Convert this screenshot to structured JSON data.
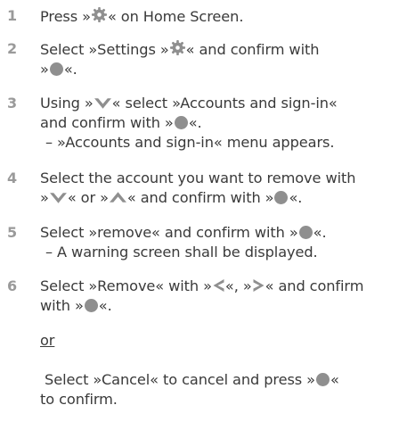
{
  "colors": {
    "text": "#3a3a3a",
    "step_number": "#9a9a9a",
    "symbol": "#8f8f8f"
  },
  "icons": {
    "gear": "gear-icon",
    "ok": "ok-button-icon",
    "down": "arrow-down-icon",
    "up": "arrow-up-icon",
    "left": "arrow-left-icon",
    "right": "arrow-right-icon"
  },
  "steps": [
    {
      "number": "1",
      "lines": [
        {
          "a": "Press »",
          "b": "« on Home Screen."
        }
      ]
    },
    {
      "number": "2",
      "lines": [
        {
          "a": "Select »Settings »",
          "b": "« and confirm with"
        },
        {
          "a": "»",
          "b": "«."
        }
      ]
    },
    {
      "number": "3",
      "lines": [
        {
          "a": "Using »",
          "b": "« select »Accounts and sign-in«"
        },
        {
          "a": "and confirm with »",
          "b": "«."
        },
        {
          "a": "– »Accounts and sign-in« menu appears."
        }
      ]
    },
    {
      "number": "4",
      "lines": [
        {
          "a": "Select the account you want to remove with"
        },
        {
          "a": "»",
          "b": "« or »",
          "c": "« and confirm with »",
          "d": "«."
        }
      ]
    },
    {
      "number": "5",
      "lines": [
        {
          "a": "Select »remove« and confirm with »",
          "b": "«."
        },
        {
          "a": "– A warning screen shall be displayed."
        }
      ]
    },
    {
      "number": "6",
      "lines": [
        {
          "a": "Select »Remove« with »",
          "b": "«, »",
          "c": "« and confirm"
        },
        {
          "a": "with »",
          "b": "«."
        }
      ]
    }
  ],
  "or_label": "or",
  "alt": {
    "line1_a": " Select »Cancel« to cancel and press »",
    "line1_b": "«",
    "line2": "to confirm."
  }
}
